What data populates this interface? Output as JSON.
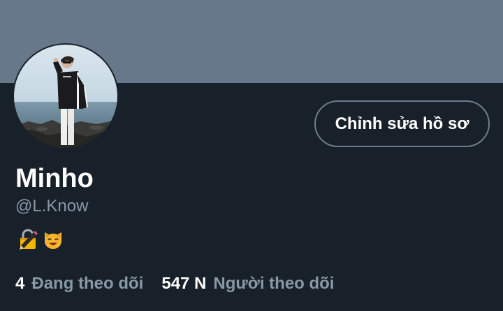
{
  "profile": {
    "edit_button_label": "Chỉnh sửa hồ sơ",
    "display_name": "Minho",
    "handle": "@L.Know",
    "bio_emojis": [
      "lock-with-pen-icon",
      "smiling-cat-icon"
    ]
  },
  "stats": {
    "following_count": "4",
    "following_label": "Đang theo dõi",
    "followers_count": "547 N",
    "followers_label": "Người theo dõi"
  },
  "colors": {
    "banner": "#66788a",
    "background": "#18202a",
    "muted_text": "#8899a6",
    "button_border": "#6e7d8c"
  }
}
